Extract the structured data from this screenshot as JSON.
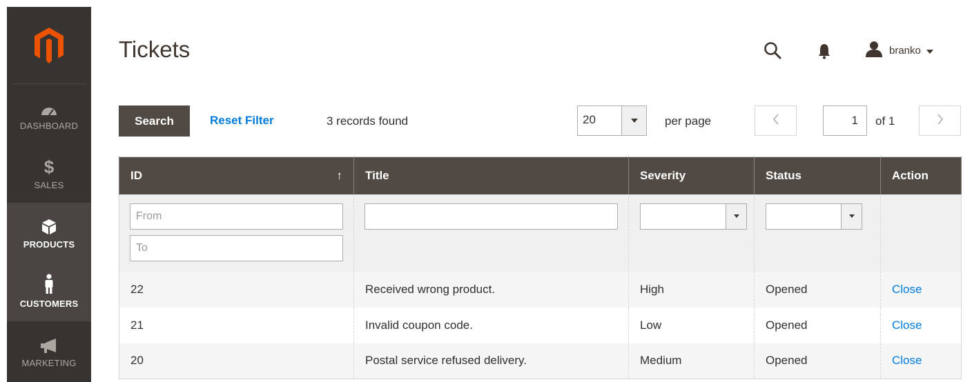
{
  "sidebar": {
    "logo_icon": "magento-logo-icon",
    "brand_color": "#eb5202",
    "items": [
      {
        "label": "DASHBOARD",
        "icon": "speedometer-icon"
      },
      {
        "label": "SALES",
        "icon": "dollar-icon"
      },
      {
        "label": "PRODUCTS",
        "icon": "cube-icon"
      },
      {
        "label": "CUSTOMERS",
        "icon": "person-icon"
      },
      {
        "label": "MARKETING",
        "icon": "megaphone-icon"
      }
    ]
  },
  "header": {
    "title": "Tickets",
    "search_icon": "search-icon",
    "notifications_icon": "bell-icon",
    "user": {
      "name": "branko",
      "icon": "user-icon"
    }
  },
  "toolbar": {
    "search_label": "Search",
    "reset_label": "Reset Filter",
    "records_text": "3 records found",
    "per_page_value": "20",
    "per_page_label": "per page",
    "current_page": "1",
    "of_pages": "of 1"
  },
  "grid": {
    "columns": [
      {
        "label": "ID",
        "sort": "asc"
      },
      {
        "label": "Title"
      },
      {
        "label": "Severity"
      },
      {
        "label": "Status"
      },
      {
        "label": "Action"
      }
    ],
    "filters": {
      "id_from_placeholder": "From",
      "id_to_placeholder": "To"
    },
    "rows": [
      {
        "id": "22",
        "title": "Received wrong product.",
        "severity": "High",
        "status": "Opened",
        "action": "Close"
      },
      {
        "id": "21",
        "title": "Invalid coupon code.",
        "severity": "Low",
        "status": "Opened",
        "action": "Close"
      },
      {
        "id": "20",
        "title": "Postal service refused delivery.",
        "severity": "Medium",
        "status": "Opened",
        "action": "Close"
      }
    ]
  },
  "colors": {
    "sidebar_bg": "#373330",
    "header_row_bg": "#514943",
    "link": "#007bdb",
    "brand": "#eb5202"
  }
}
